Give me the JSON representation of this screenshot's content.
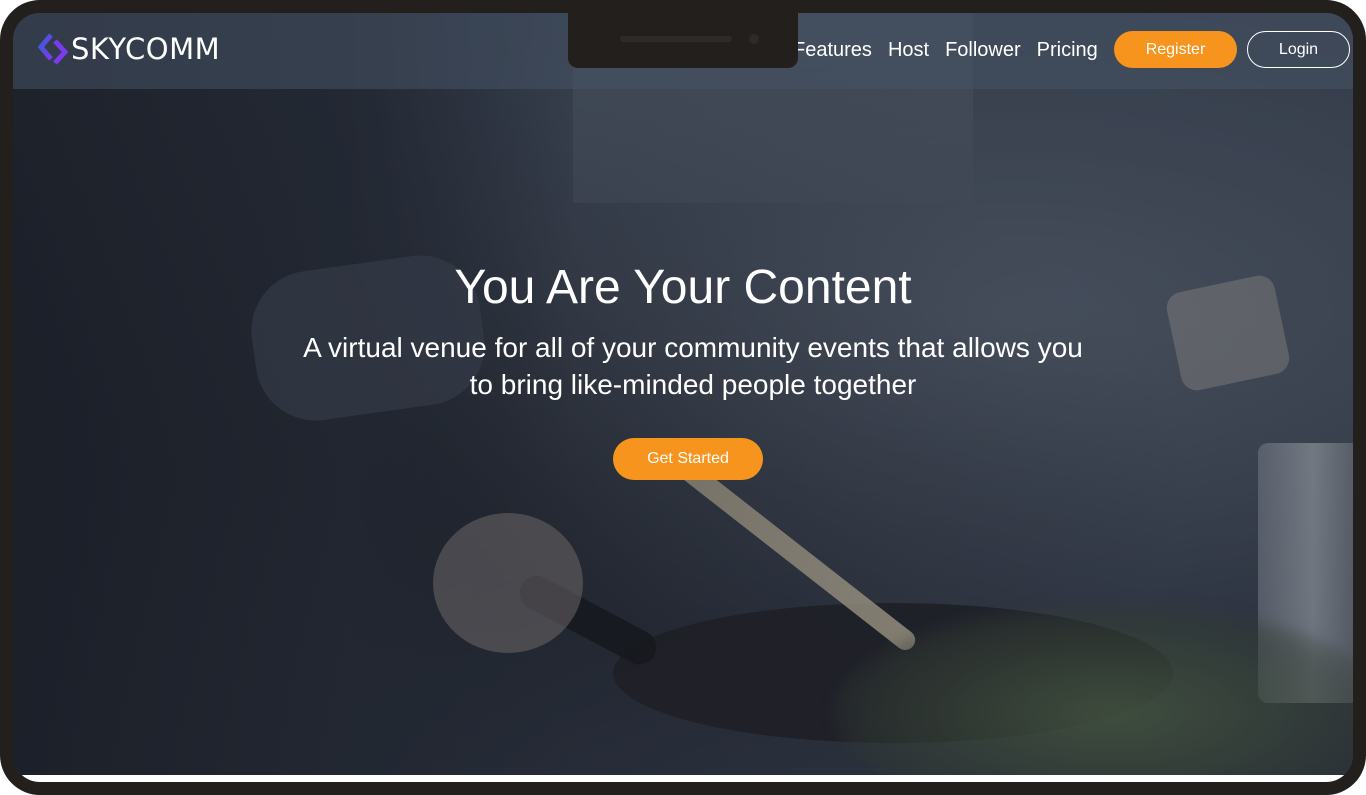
{
  "brand": {
    "name": "SKYCOMM",
    "accent_color": "#f7941d",
    "logo_colors": [
      "#3b5bdb",
      "#7c3aed"
    ]
  },
  "nav": {
    "links": [
      {
        "label": "Features"
      },
      {
        "label": "Host"
      },
      {
        "label": "Follower"
      },
      {
        "label": "Pricing"
      }
    ],
    "register_label": "Register",
    "login_label": "Login"
  },
  "hero": {
    "title": "You Are Your Content",
    "subtitle": "A virtual venue for all of your community events that allows you to bring like-minded people together",
    "cta_label": "Get Started"
  }
}
